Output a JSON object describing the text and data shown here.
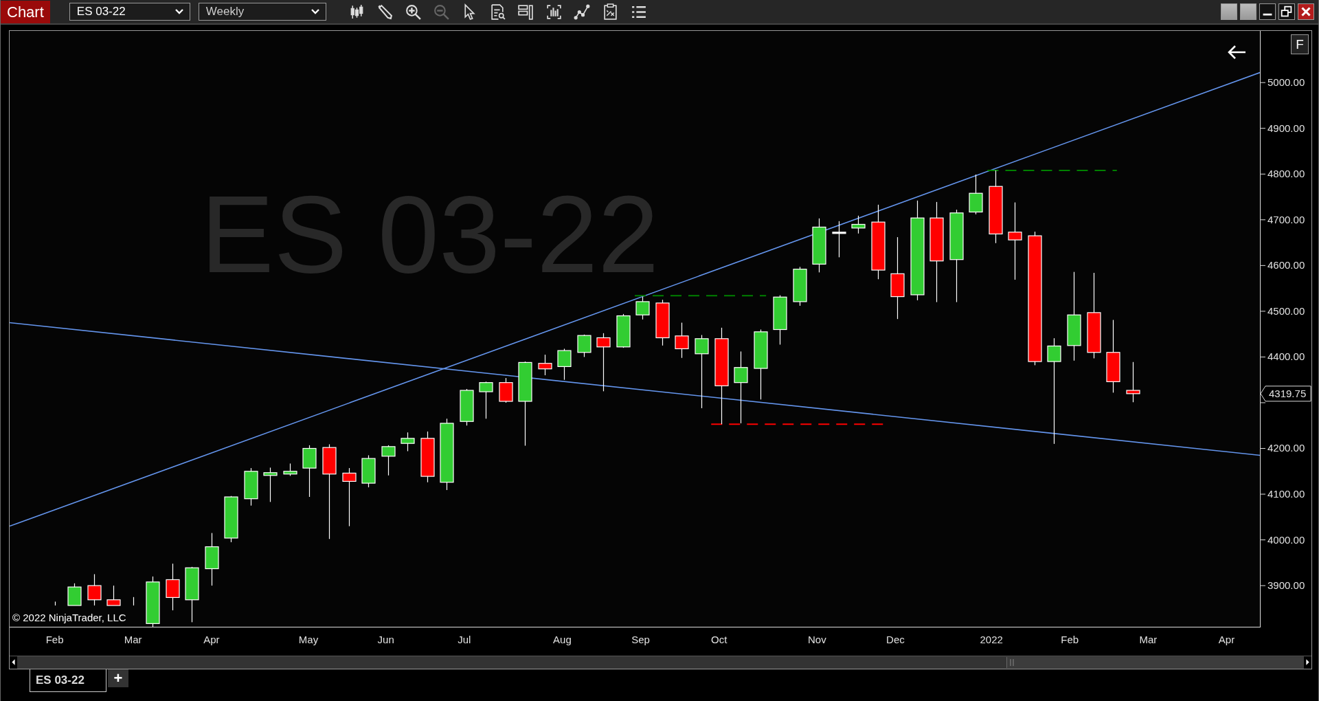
{
  "window": {
    "title": "Chart"
  },
  "toolbar": {
    "instrument": "ES 03-22",
    "interval": "Weekly",
    "tools": [
      {
        "disabled": false
      },
      {
        "disabled": false
      },
      {
        "disabled": false
      },
      {
        "disabled": true
      },
      {
        "disabled": false
      },
      {
        "disabled": false
      },
      {
        "disabled": false
      },
      {
        "disabled": false
      },
      {
        "disabled": false
      },
      {
        "disabled": false
      },
      {
        "disabled": false
      }
    ]
  },
  "chart": {
    "watermark": "ES 03-22",
    "copyright": "© 2022 NinjaTrader, LLC",
    "last_price": "4319.75",
    "axis_button": "F",
    "price_axis_labels": [
      "5000.00",
      "4900.00",
      "4800.00",
      "4700.00",
      "4600.00",
      "4500.00",
      "4400.00",
      "4200.00",
      "4100.00",
      "4000.00",
      "3900.00"
    ],
    "time_axis_labels": [
      "Feb",
      "Mar",
      "Apr",
      "May",
      "Jun",
      "Jul",
      "Aug",
      "Sep",
      "Oct",
      "Nov",
      "Dec",
      "2022",
      "Feb",
      "Mar",
      "Apr"
    ]
  },
  "tabs": [
    {
      "label": "ES 03-22",
      "selected": true
    }
  ],
  "add_tab": "+"
}
